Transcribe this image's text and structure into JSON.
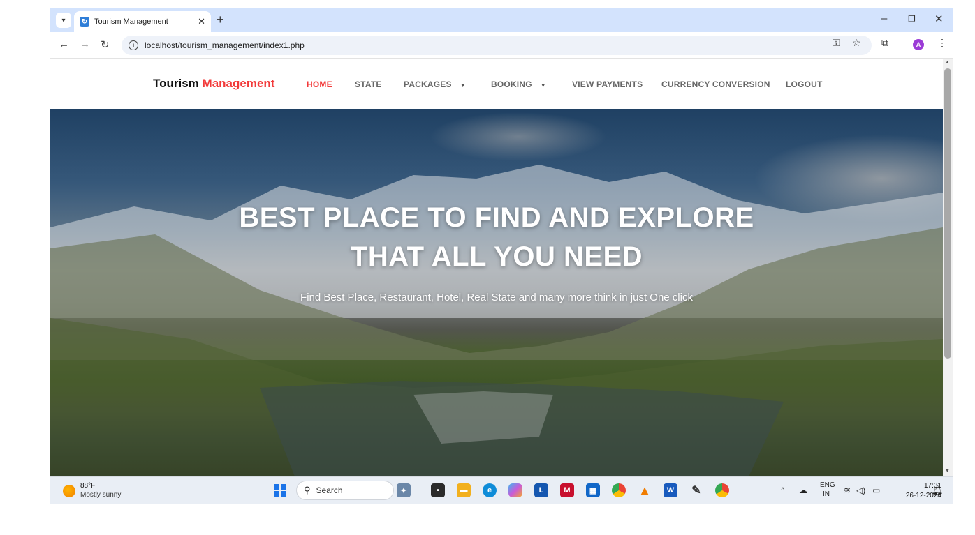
{
  "browser": {
    "tab_title": "Tourism Management",
    "url": "localhost/tourism_management/index1.php",
    "new_tab": "+",
    "profile_initial": "A"
  },
  "site": {
    "brand_main": "Tourism",
    "brand_accent": "Management",
    "nav": [
      {
        "label": "HOME",
        "active": true
      },
      {
        "label": "STATE"
      },
      {
        "label": "PACKAGES",
        "dropdown": true
      },
      {
        "label": "BOOKING",
        "dropdown": true
      },
      {
        "label": "VIEW PAYMENTS"
      },
      {
        "label": "CURRENCY CONVERSION"
      },
      {
        "label": "LOGOUT"
      }
    ],
    "hero": {
      "title_line1": "BEST PLACE TO FIND AND EXPLORE",
      "title_line2": "THAT ALL YOU NEED",
      "subtitle": "Find Best Place, Restaurant, Hotel, Real State and many more think in just One click"
    },
    "colors": {
      "accent": "#f23a3a",
      "nav_text": "#666666"
    }
  },
  "taskbar": {
    "weather_temp": "88°F",
    "weather_desc": "Mostly sunny",
    "search_label": "Search",
    "lang_top": "ENG",
    "lang_bottom": "IN",
    "time": "17:31",
    "date": "26-12-2024",
    "apps": [
      "file-explorer",
      "edge",
      "copilot",
      "teams-L",
      "mcafee",
      "store",
      "chrome",
      "vlc",
      "word",
      "paint",
      "chrome-profile"
    ]
  }
}
